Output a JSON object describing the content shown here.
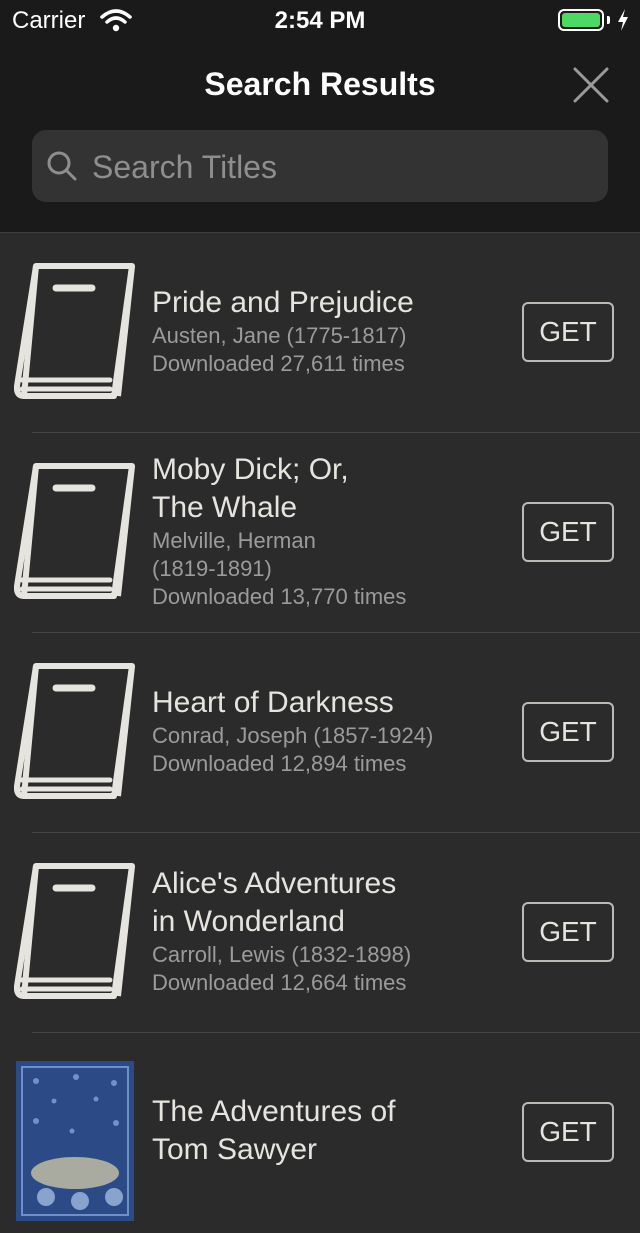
{
  "status_bar": {
    "carrier": "Carrier",
    "time": "2:54 PM",
    "battery_level": 1.0
  },
  "nav": {
    "title": "Search Results",
    "search_placeholder": "Search Titles"
  },
  "results": [
    {
      "title_lines": [
        "Pride and Prejudice"
      ],
      "author_lines": [
        "Austen, Jane (1775-1817)"
      ],
      "downloads": "Downloaded 27,611 times",
      "button": "GET",
      "thumb": "book-icon"
    },
    {
      "title_lines": [
        "Moby Dick; Or,",
        "The Whale"
      ],
      "author_lines": [
        "Melville, Herman",
        "(1819-1891)"
      ],
      "downloads": "Downloaded 13,770 times",
      "button": "GET",
      "thumb": "book-icon"
    },
    {
      "title_lines": [
        "Heart of Darkness"
      ],
      "author_lines": [
        "Conrad, Joseph (1857-1924)"
      ],
      "downloads": "Downloaded 12,894 times",
      "button": "GET",
      "thumb": "book-icon"
    },
    {
      "title_lines": [
        "Alice's Adventures",
        "in Wonderland"
      ],
      "author_lines": [
        "Carroll, Lewis (1832-1898)"
      ],
      "downloads": "Downloaded 12,664 times",
      "button": "GET",
      "thumb": "book-icon"
    },
    {
      "title_lines": [
        "The Adventures of",
        "Tom Sawyer"
      ],
      "author_lines": [],
      "downloads": "",
      "button": "GET",
      "thumb": "cover-image"
    }
  ],
  "colors": {
    "background": "#2b2b2b",
    "header": "#1a1a1a",
    "text": "#e6e4df",
    "secondary_text": "#9b9b9b",
    "battery": "#4cd964"
  }
}
